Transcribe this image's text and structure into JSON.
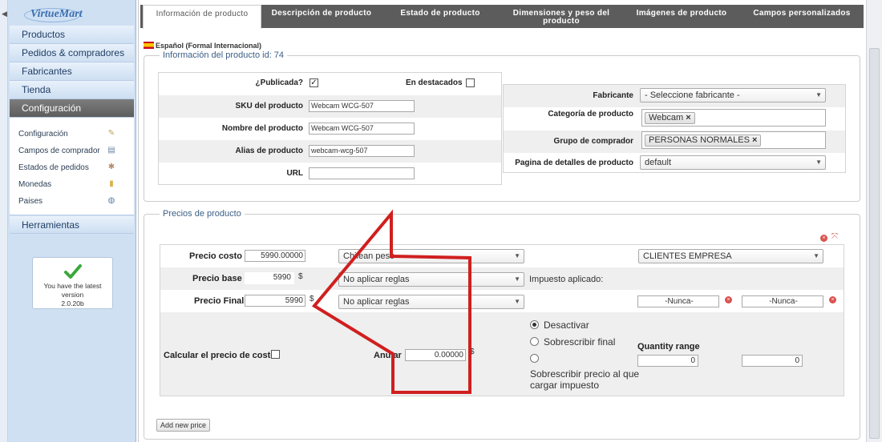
{
  "sidebar": {
    "logo": "VirtueMart",
    "items": [
      "Productos",
      "Pedidos & compradores",
      "Fabricantes",
      "Tienda",
      "Configuración"
    ],
    "active_item": "Configuración",
    "subitems": [
      {
        "label": "Configuración",
        "icon": "wrench-icon"
      },
      {
        "label": "Campos de comprador",
        "icon": "form-icon"
      },
      {
        "label": "Estados de pedidos",
        "icon": "status-icon"
      },
      {
        "label": "Monedas",
        "icon": "coins-icon"
      },
      {
        "label": "Paises",
        "icon": "globe-icon"
      }
    ],
    "tools": "Herramientas",
    "version_lines": [
      "You have the latest",
      "version",
      "2.0.20b"
    ]
  },
  "tabs": [
    "Información de producto",
    "Descripción de producto",
    "Estado de producto",
    "Dimensiones y peso del producto",
    "Imágenes de producto",
    "Campos personalizados"
  ],
  "language": "Español (Formal Internacional)",
  "product_info": {
    "legend": "Información del producto id: 74",
    "published_label": "¿Publicada?",
    "published": true,
    "featured_label": "En destacados",
    "featured": false,
    "sku_label": "SKU del producto",
    "sku": "Webcam WCG-507",
    "name_label": "Nombre del producto",
    "name": "Webcam WCG-507",
    "alias_label": "Alias de producto",
    "alias": "webcam-wcg-507",
    "url_label": "URL",
    "url": "",
    "manufacturer_label": "Fabricante",
    "manufacturer": "- Seleccione fabricante -",
    "category_label": "Categoría de producto",
    "category_tag": "Webcam",
    "shopper_group_label": "Grupo de comprador",
    "shopper_group_tag": "PERSONAS NORMALES",
    "details_page_label": "Pagina de detalles de producto",
    "details_page": "default"
  },
  "prices": {
    "legend": "Precios de producto",
    "cost_label": "Precio costo",
    "cost": "5990.00000",
    "currency_select": "Chilean peso",
    "group_select": "CLIENTES EMPRESA",
    "base_label": "Precio base",
    "base": "5990",
    "currency_symbol": "$",
    "base_rule": "No aplicar reglas",
    "tax_applied": "Impuesto aplicado:",
    "final_label": "Precio Final",
    "final": "5990",
    "final_rule": "No aplicar reglas",
    "never_from": "-Nunca-",
    "never_to": "-Nunca-",
    "calc_cost_label": "Calcular el precio de coste",
    "override_label": "Anular",
    "override": "0.00000",
    "opt_disable": "Desactivar",
    "opt_override_final": "Sobrescribir final",
    "opt_override_pretax": "Sobrescribir precio al que cargar impuesto",
    "quantity_label": "Quantity range",
    "qty_from": "0",
    "qty_to": "0"
  },
  "add_price": "Add new price"
}
